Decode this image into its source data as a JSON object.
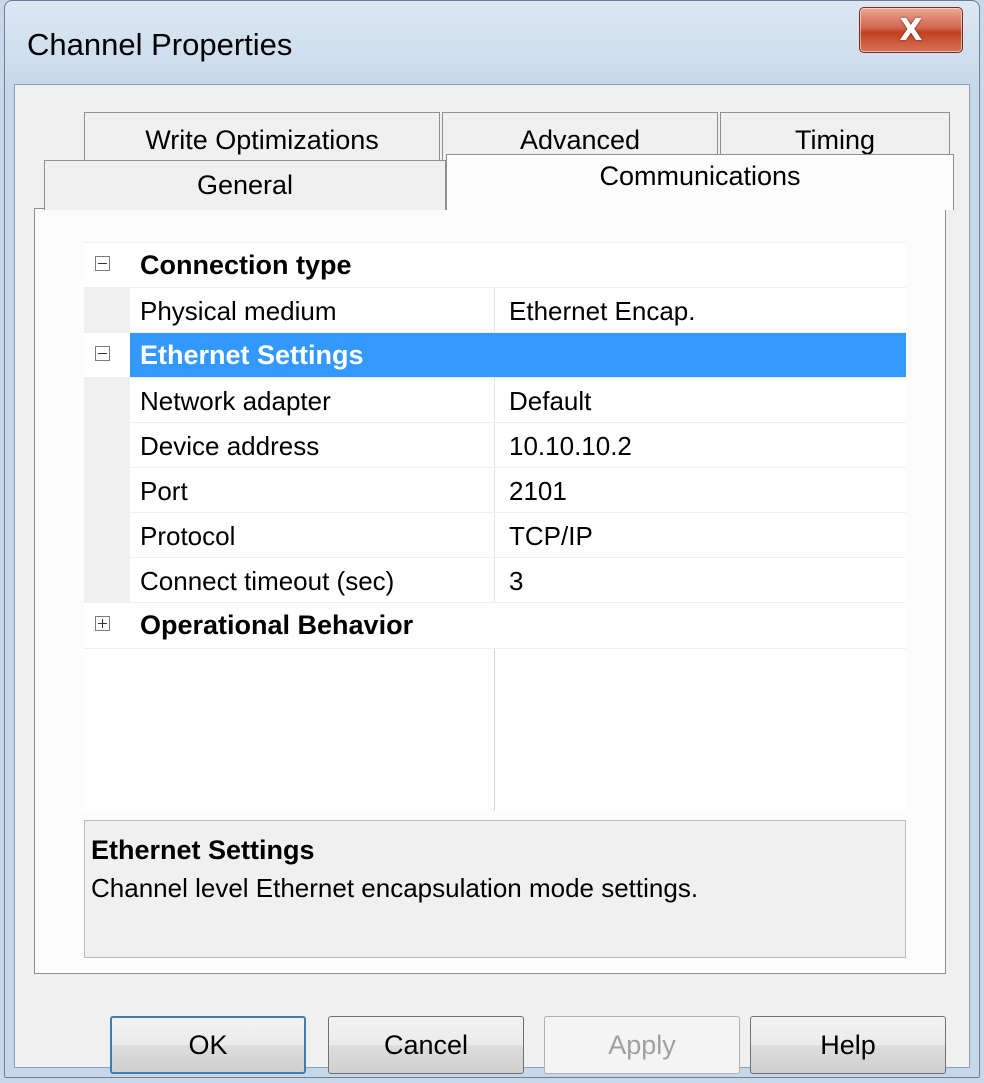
{
  "window": {
    "title": "Channel Properties",
    "close_glyph": "X"
  },
  "tabs": {
    "back_row": [
      "Write Optimizations",
      "Advanced",
      "Timing"
    ],
    "front_row": [
      "General",
      "Communications"
    ],
    "active": "Communications"
  },
  "grid": {
    "categories": [
      {
        "label": "Connection type",
        "expanded": true,
        "rows": [
          {
            "name": "Physical medium",
            "value": "Ethernet Encap."
          }
        ]
      },
      {
        "label": "Ethernet Settings",
        "expanded": true,
        "selected": true,
        "rows": [
          {
            "name": "Network adapter",
            "value": "Default"
          },
          {
            "name": "Device address",
            "value": "10.10.10.2"
          },
          {
            "name": "Port",
            "value": "2101"
          },
          {
            "name": "Protocol",
            "value": "TCP/IP"
          },
          {
            "name": "Connect timeout (sec)",
            "value": "3"
          }
        ]
      },
      {
        "label": "Operational Behavior",
        "expanded": false,
        "rows": []
      }
    ]
  },
  "help": {
    "title": "Ethernet Settings",
    "description": "Channel level Ethernet encapsulation mode settings."
  },
  "buttons": {
    "ok": "OK",
    "cancel": "Cancel",
    "apply": "Apply",
    "help": "Help"
  },
  "colors": {
    "selection": "#3399ff",
    "close_button": "#c2401f"
  },
  "icons": {
    "collapse": "minus-box-icon",
    "expand": "plus-box-icon"
  }
}
